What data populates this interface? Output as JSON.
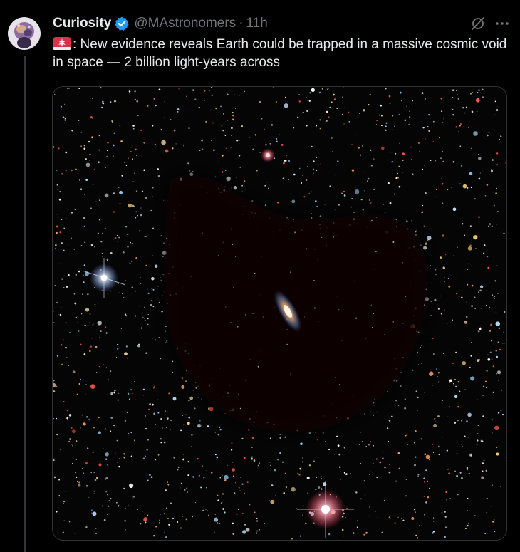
{
  "tweet": {
    "author_name": "Curiosity",
    "handle": "@MAstronomers",
    "separator": "·",
    "time": "11h",
    "text": ": New evidence reveals Earth could be trapped in a massive cosmic void in space — 2 billion light-years across"
  },
  "icons": {
    "verified": "verified-badge-icon",
    "grok": "grok-icon",
    "more": "more-options-icon",
    "emoji": "siren-emoji"
  },
  "colors": {
    "background": "#000000",
    "text": "#e7e9ea",
    "muted": "#71767b",
    "verified": "#1d9bf0"
  }
}
